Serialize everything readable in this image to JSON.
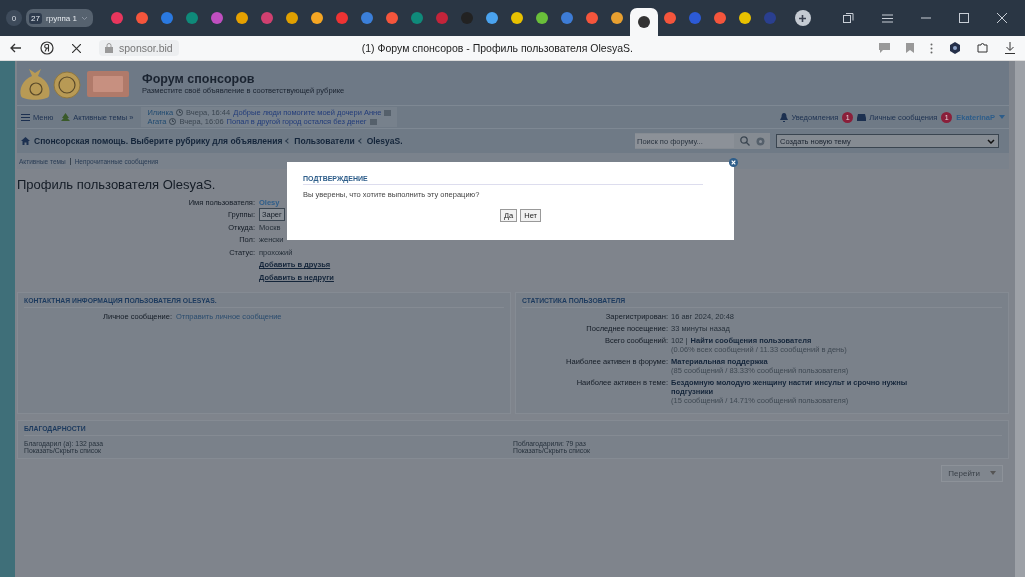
{
  "browser": {
    "group_counter": "0",
    "group": {
      "count": "27",
      "label": "группа 1"
    },
    "tabs": [
      {
        "color": "#e8365d",
        "selected": false
      },
      {
        "color": "#f5553c",
        "selected": false
      },
      {
        "color": "#2a79e0",
        "selected": false
      },
      {
        "color": "#0f8a7a",
        "selected": false
      },
      {
        "color": "#c04fc0",
        "selected": false
      },
      {
        "color": "#e6a100",
        "selected": false
      },
      {
        "color": "#d04070",
        "selected": false
      },
      {
        "color": "#e0a000",
        "selected": false
      },
      {
        "color": "#f5a623",
        "selected": false
      },
      {
        "color": "#ee3333",
        "selected": false
      },
      {
        "color": "#3b7fd9",
        "selected": false
      },
      {
        "color": "#f5553c",
        "selected": false
      },
      {
        "color": "#0f8a7a",
        "selected": false
      },
      {
        "color": "#c3243a",
        "selected": false
      },
      {
        "color": "#222222",
        "selected": false
      },
      {
        "color": "#4aa3ef",
        "selected": false
      },
      {
        "color": "#e8c100",
        "selected": false
      },
      {
        "color": "#6abf3a",
        "selected": false
      },
      {
        "color": "#3d7cd6",
        "selected": false
      },
      {
        "color": "#f5553c",
        "selected": false
      },
      {
        "color": "#e8a030",
        "selected": false
      },
      {
        "color": "#333333",
        "selected": true
      },
      {
        "color": "#f5553c",
        "selected": false
      },
      {
        "color": "#2c5ad6",
        "selected": false
      },
      {
        "color": "#f5553c",
        "selected": false
      },
      {
        "color": "#e8c100",
        "selected": false
      },
      {
        "color": "#2a3f8f",
        "selected": false
      }
    ],
    "url": "sponsor.bid",
    "page_title": "(1) Форум спонсоров - Профиль пользователя OlesyaS."
  },
  "forum": {
    "title": "Форум спонсоров",
    "subtitle": "Разместите своё объявление в соответствующей рубрике",
    "nav": {
      "menu": "Меню",
      "active": "Активные темы »",
      "ticker": [
        {
          "author": "Илинка",
          "time": "Вчера, 16:44",
          "topic": "Добрые люди помогите моей дочери Анне"
        },
        {
          "author": "Агата",
          "time": "Вчера, 16:06",
          "topic": "Попал в другой город остался без денег"
        }
      ],
      "notifications": {
        "label": "Уведомления",
        "count": "1"
      },
      "messages": {
        "label": "Личные сообщения",
        "count": "1"
      },
      "user": "EkaterinaP"
    },
    "breadcrumbs": [
      "Спонсорская помощь. Выберите рубрику для объявления",
      "Пользователи",
      "OlesyaS."
    ],
    "search": {
      "placeholder": "Поиск по форуму..."
    },
    "new_topic": "Создать новую тему",
    "subnav": [
      "Активные темы",
      "Непрочитанные сообщения"
    ]
  },
  "profile": {
    "title": "Профиль пользователя OlesyaS.",
    "fields": [
      {
        "kind": "link",
        "label": "Имя пользователя:",
        "value": "Olesy"
      },
      {
        "kind": "select",
        "label": "Группы:",
        "value": "Зарег"
      },
      {
        "kind": "text",
        "label": "Откуда:",
        "value": "Москв"
      },
      {
        "kind": "text",
        "label": "Пол:",
        "value": "женски"
      },
      {
        "kind": "text",
        "label": "Статус:",
        "value": "прохожий"
      }
    ],
    "actions": [
      "Добавить в друзья",
      "Добавить в недруги"
    ]
  },
  "contact": {
    "heading": "КОНТАКТНАЯ ИНФОРМАЦИЯ ПОЛЬЗОВАТЕЛЯ OLESYAS.",
    "rows": [
      {
        "label": "Личное сообщение:",
        "link": "Отправить личное сообщение"
      }
    ]
  },
  "stats": {
    "heading": "СТАТИСТИКА ПОЛЬЗОВАТЕЛЯ",
    "rows": [
      {
        "label": "Зарегистрирован:",
        "value": "16 авг 2024, 20:48"
      },
      {
        "label": "Последнее посещение:",
        "value": "33 минуты назад"
      },
      {
        "label": "Всего сообщений:",
        "value": "102 |",
        "link": "Найти сообщения пользователя",
        "note": "(0.06% всех сообщений / 11.33 сообщений в день)"
      },
      {
        "label": "Наиболее активен в форуме:",
        "link": "Материальная поддержка",
        "note": "(85 сообщений / 83.33% сообщений пользователя)"
      },
      {
        "label": "Наиболее активен в теме:",
        "link": "Бездомную молодую женщину настиг инсульт и срочно нужны подгузники",
        "note": "(15 сообщений / 14.71% сообщений пользователя)"
      }
    ]
  },
  "thanks": {
    "heading": "БЛАГОДАРНОСТИ",
    "columns": [
      {
        "count": "Благодарил (а): 132 раза",
        "toggle": "Показать/Скрыть список"
      },
      {
        "count": "Поблагодарили: 79 раз",
        "toggle": "Показать/Скрыть список"
      }
    ]
  },
  "jump": "Перейти",
  "dialog": {
    "title": "ПОДТВЕРЖДЕНИЕ",
    "message": "Вы уверены, что хотите выполнить эту операцию?",
    "buttons": [
      "Да",
      "Нет"
    ]
  }
}
